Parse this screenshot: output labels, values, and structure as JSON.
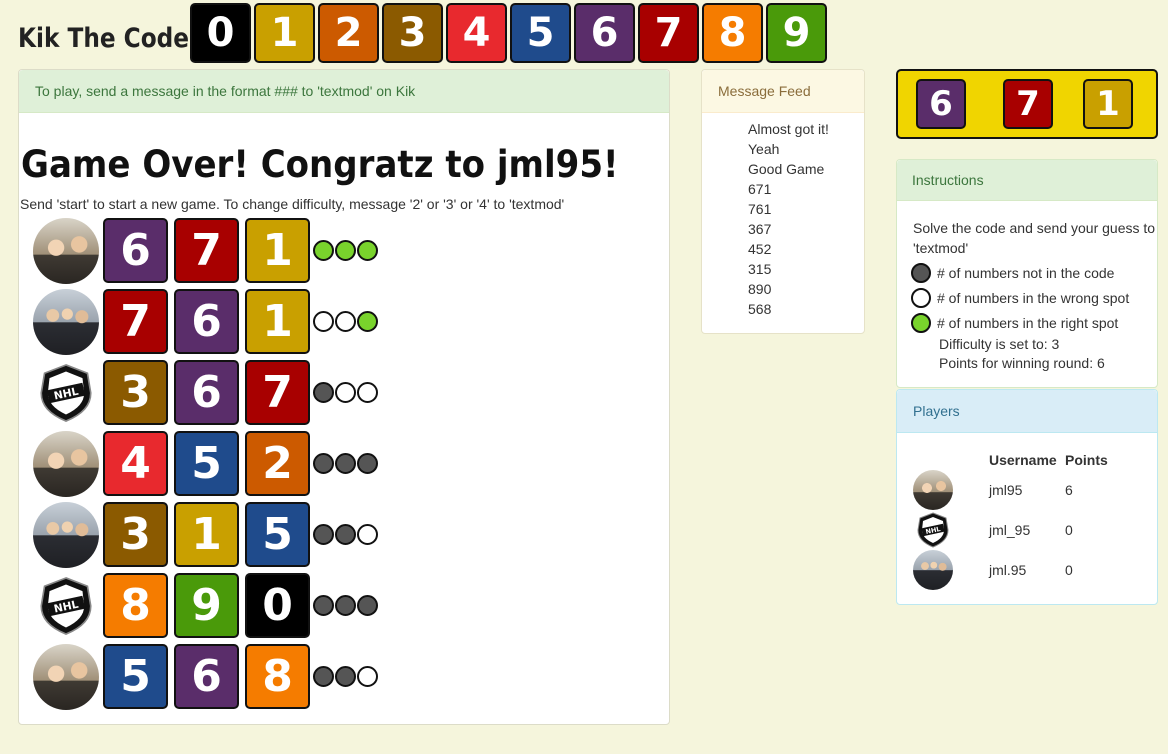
{
  "header": {
    "title": "Kik The Code",
    "digits": [
      {
        "label": "0",
        "color": "#000000"
      },
      {
        "label": "1",
        "color": "#c9a000"
      },
      {
        "label": "2",
        "color": "#cc5a00"
      },
      {
        "label": "3",
        "color": "#8b5a00"
      },
      {
        "label": "4",
        "color": "#e8292e"
      },
      {
        "label": "5",
        "color": "#1f4b8c"
      },
      {
        "label": "6",
        "color": "#5a2d6a"
      },
      {
        "label": "7",
        "color": "#a80000"
      },
      {
        "label": "8",
        "color": "#f57c00"
      },
      {
        "label": "9",
        "color": "#4a9a0a"
      }
    ]
  },
  "main": {
    "heading": "To play, send a message in the format ### to 'textmod' on Kik",
    "game_over": "Game Over! Congratz to jml95!",
    "subtext": "Send 'start' to start a new game. To change difficulty, message '2' or '3' or '4' to 'textmod'",
    "guesses": [
      {
        "avatar": "photo",
        "digits": [
          "6",
          "7",
          "1"
        ],
        "pegs": [
          "green",
          "green",
          "green"
        ]
      },
      {
        "avatar": "group",
        "digits": [
          "7",
          "6",
          "1"
        ],
        "pegs": [
          "white",
          "white",
          "green"
        ]
      },
      {
        "avatar": "nhl",
        "digits": [
          "3",
          "6",
          "7"
        ],
        "pegs": [
          "black",
          "white",
          "white"
        ]
      },
      {
        "avatar": "photo",
        "digits": [
          "4",
          "5",
          "2"
        ],
        "pegs": [
          "black",
          "black",
          "black"
        ]
      },
      {
        "avatar": "group",
        "digits": [
          "3",
          "1",
          "5"
        ],
        "pegs": [
          "black",
          "black",
          "white"
        ]
      },
      {
        "avatar": "nhl",
        "digits": [
          "8",
          "9",
          "0"
        ],
        "pegs": [
          "black",
          "black",
          "black"
        ]
      },
      {
        "avatar": "photo",
        "digits": [
          "5",
          "6",
          "8"
        ],
        "pegs": [
          "black",
          "black",
          "white"
        ]
      }
    ]
  },
  "feed": {
    "heading": "Message Feed",
    "messages": [
      "Almost got it!",
      "Yeah",
      "Good Game",
      "671",
      "761",
      "367",
      "452",
      "315",
      "890",
      "568"
    ]
  },
  "code": [
    "6",
    "7",
    "1"
  ],
  "instructions": {
    "heading": "Instructions",
    "intro": "Solve the code and send your guess to 'textmod'",
    "legend_black": "# of numbers not in the code",
    "legend_white": "# of numbers in the wrong spot",
    "legend_green": "# of numbers in the right spot",
    "difficulty": "Difficulty is set to: 3",
    "points": "Points for winning round: 6"
  },
  "players": {
    "heading": "Players",
    "col_username": "Username",
    "col_points": "Points",
    "rows": [
      {
        "avatar": "photo",
        "username": "jml95",
        "points": "6"
      },
      {
        "avatar": "nhl",
        "username": "jml_95",
        "points": "0"
      },
      {
        "avatar": "group",
        "username": "jml.95",
        "points": "0"
      }
    ]
  }
}
